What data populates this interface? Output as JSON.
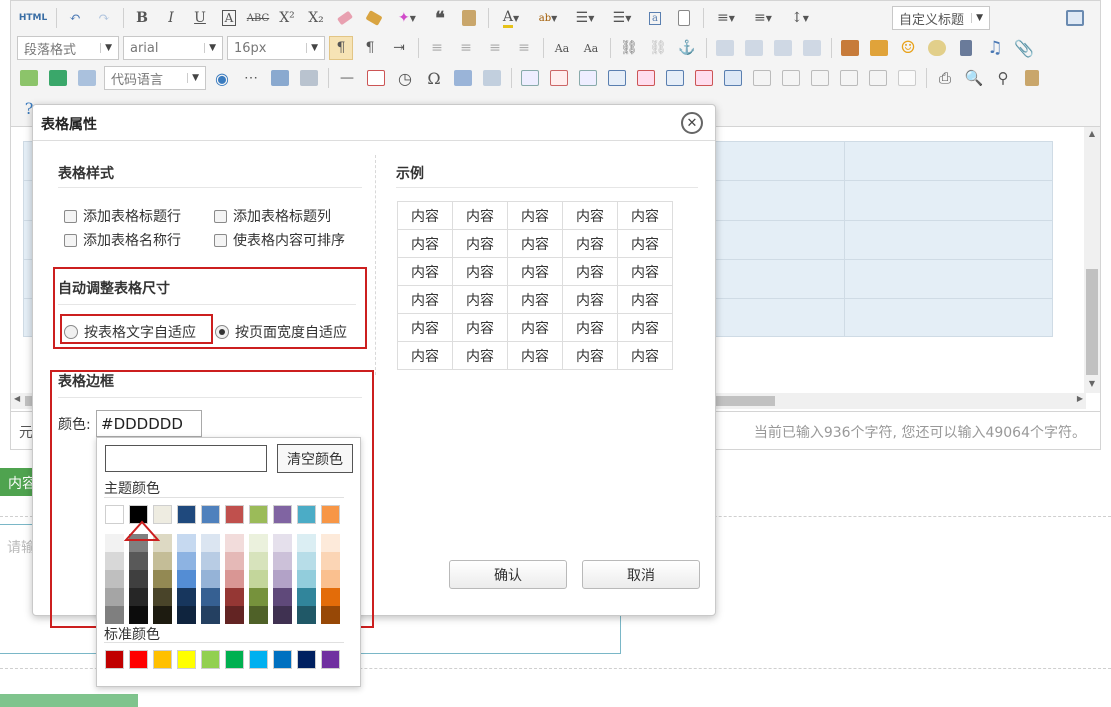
{
  "toolbar": {
    "html_label": "HTML",
    "paragraph_format": "段落格式",
    "font_family": "arial",
    "font_size": "16px",
    "code_language": "代码语言",
    "custom_title": "自定义标题"
  },
  "editor": {
    "status_left": "元",
    "status_right": "当前已输入936个字符, 您还可以输入49064个字符。"
  },
  "background": {
    "tab_label": "内容",
    "textarea_placeholder": "请输"
  },
  "dialog": {
    "title": "表格属性",
    "close_symbol": "✕",
    "table_style": {
      "title": "表格样式",
      "options": [
        "添加表格标题行",
        "添加表格标题列",
        "添加表格名称行",
        "使表格内容可排序"
      ]
    },
    "auto_size": {
      "title": "自动调整表格尺寸",
      "options": [
        "按表格文字自适应",
        "按页面宽度自适应"
      ],
      "selected_index": 1
    },
    "border": {
      "title": "表格边框",
      "color_label": "颜色:",
      "color_value": "#DDDDDD"
    },
    "example": {
      "title": "示例",
      "cell_text": "内容",
      "rows": [
        [
          "内容",
          "内容",
          "内容",
          "内容",
          "内容"
        ],
        [
          "内容",
          "内容",
          "内容",
          "内容",
          "内容"
        ],
        [
          "内容",
          "内容",
          "内容",
          "内容",
          "内容"
        ],
        [
          "内容",
          "内容",
          "内容",
          "内容",
          "内容"
        ],
        [
          "内容",
          "内容",
          "内容",
          "内容",
          "内容"
        ],
        [
          "内容",
          "内容",
          "内容",
          "内容",
          "内容"
        ]
      ]
    },
    "confirm_label": "确认",
    "cancel_label": "取消"
  },
  "color_picker": {
    "clear_label": "清空颜色",
    "theme_title": "主题颜色",
    "standard_title": "标准颜色",
    "theme_colors": [
      "#ffffff",
      "#000000",
      "#eeece1",
      "#1f497d",
      "#4f81bd",
      "#c0504d",
      "#9bbb59",
      "#8064a2",
      "#4bacc6",
      "#f79646"
    ],
    "theme_tones": [
      [
        "#f2f2f2",
        "#d8d8d8",
        "#bfbfbf",
        "#a5a5a5",
        "#7f7f7f"
      ],
      [
        "#7f7f7f",
        "#595959",
        "#3f3f3f",
        "#262626",
        "#0c0c0c"
      ],
      [
        "#ddd9c3",
        "#c4bd97",
        "#938953",
        "#494429",
        "#1d1b10"
      ],
      [
        "#c6d9f0",
        "#8db3e2",
        "#548dd4",
        "#17365d",
        "#0f243e"
      ],
      [
        "#dbe5f1",
        "#b8cce4",
        "#95b3d7",
        "#366092",
        "#244061"
      ],
      [
        "#f2dcdb",
        "#e5b9b7",
        "#d99694",
        "#953734",
        "#632423"
      ],
      [
        "#ebf1dd",
        "#d7e3bc",
        "#c3d69b",
        "#76923c",
        "#4f6128"
      ],
      [
        "#e5e0ec",
        "#ccc1d9",
        "#b2a2c7",
        "#5f497a",
        "#3f3151"
      ],
      [
        "#dbeef3",
        "#b7dde8",
        "#92cddc",
        "#31859b",
        "#205867"
      ],
      [
        "#fdeada",
        "#fbd5b5",
        "#fac08f",
        "#e36c09",
        "#974806"
      ]
    ],
    "standard_colors": [
      "#c00000",
      "#ff0000",
      "#ffc000",
      "#ffff00",
      "#92d050",
      "#00b050",
      "#00b0f0",
      "#0070c0",
      "#002060",
      "#7030a0"
    ]
  },
  "colors": {
    "highlight_red": "#cc1f1f",
    "preview_border": "#dddddd",
    "table_area": "#e4eef6"
  }
}
